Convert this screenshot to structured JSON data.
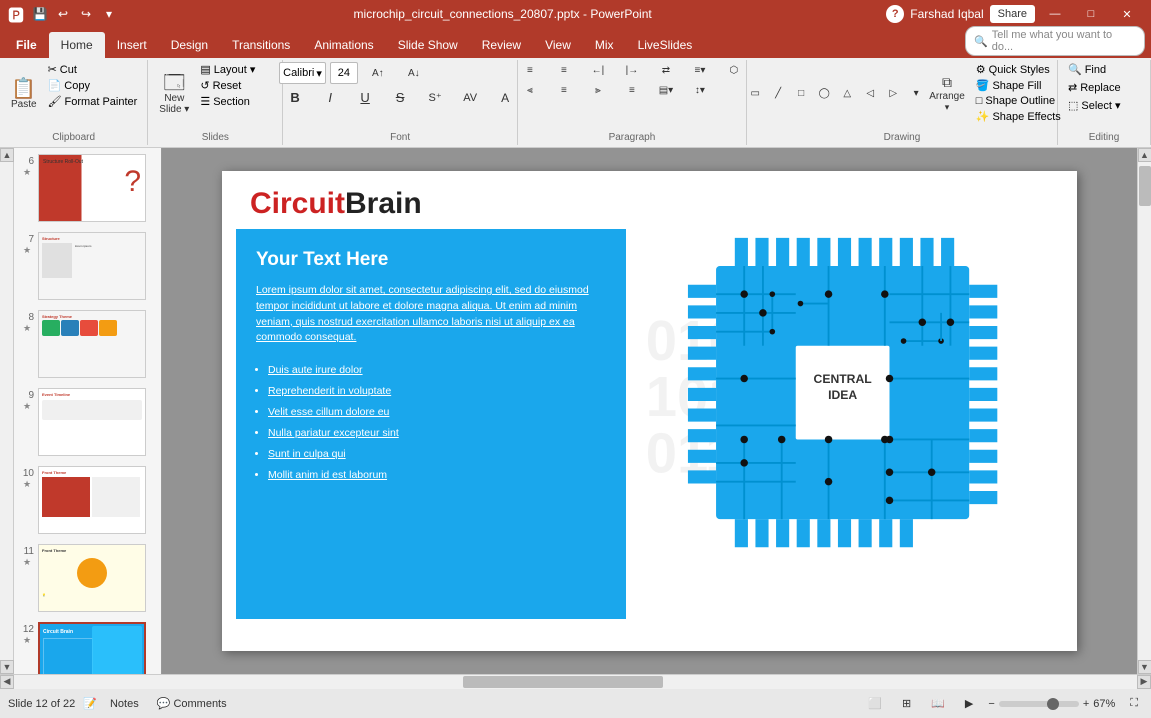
{
  "window": {
    "title": "microchip_circuit_connections_20807.pptx - PowerPoint",
    "controls": {
      "minimize": "—",
      "maximize": "□",
      "close": "✕"
    }
  },
  "titlebar": {
    "quick_access": [
      "💾",
      "↩",
      "↪"
    ],
    "title": "microchip_circuit_connections_20807.pptx - PowerPoint"
  },
  "ribbon": {
    "tabs": [
      "File",
      "Home",
      "Insert",
      "Design",
      "Transitions",
      "Animations",
      "Slide Show",
      "Review",
      "View",
      "Mix",
      "LiveSlides"
    ],
    "active_tab": "Home",
    "groups": {
      "clipboard": {
        "label": "Clipboard",
        "paste": "Paste",
        "cut": "Cut",
        "copy": "Copy",
        "format_painter": "Format Painter"
      },
      "slides": {
        "label": "Slides",
        "new_slide": "New Slide",
        "layout": "Layout",
        "reset": "Reset",
        "section": "Section"
      },
      "font": {
        "label": "Font",
        "font_name": "Calibri",
        "font_size": "24",
        "bold": "B",
        "italic": "I",
        "underline": "U",
        "strikethrough": "S",
        "increase_font": "A↑",
        "decrease_font": "A↓"
      },
      "paragraph": {
        "label": "Paragraph",
        "bullets": "≡",
        "numbering": "≡",
        "indent_decrease": "←",
        "indent_increase": "→",
        "line_spacing": "↕"
      },
      "drawing": {
        "label": "Drawing",
        "arrange": "Arrange",
        "quick_styles": "Quick Styles",
        "shape_fill": "Shape Fill",
        "shape_outline": "Shape Outline",
        "shape_effects": "Shape Effects"
      },
      "editing": {
        "label": "Editing",
        "find": "Find",
        "replace": "Replace",
        "select": "Select ▾"
      }
    }
  },
  "slides": [
    {
      "num": "6",
      "active": false
    },
    {
      "num": "7",
      "active": false
    },
    {
      "num": "8",
      "active": false
    },
    {
      "num": "9",
      "active": false
    },
    {
      "num": "10",
      "active": false
    },
    {
      "num": "11",
      "active": false
    },
    {
      "num": "12",
      "active": true
    }
  ],
  "slide": {
    "title_red": "Circuit",
    "title_black": " Brain",
    "blue_box": {
      "heading": "Your Text Here",
      "body": "Lorem ipsum dolor sit amet, consectetur adipiscing elit, sed do eiusmod tempor incididunt ut labore et dolore magna aliqua. Ut enim ad minim veniam, quis nostrud exercitation ullamco laboris nisi ut aliquip ex ea commodo consequat.",
      "bullets": [
        "Duis aute irure dolor",
        "Reprehenderit in voluptate",
        "Velit esse cillum dolore eu",
        "Nulla pariatur excepteur sint",
        "Sunt in culpa qui",
        "Mollit anim id est laborum"
      ]
    },
    "chip": {
      "central_text": "CENTRAL\nIDEA"
    }
  },
  "statusbar": {
    "slide_info": "Slide 12 of 22",
    "notes": "Notes",
    "comments": "Comments",
    "zoom": "67%"
  },
  "tell_me": "Tell me what you want to do...",
  "user": "Farshad Iqbal",
  "share": "Share"
}
